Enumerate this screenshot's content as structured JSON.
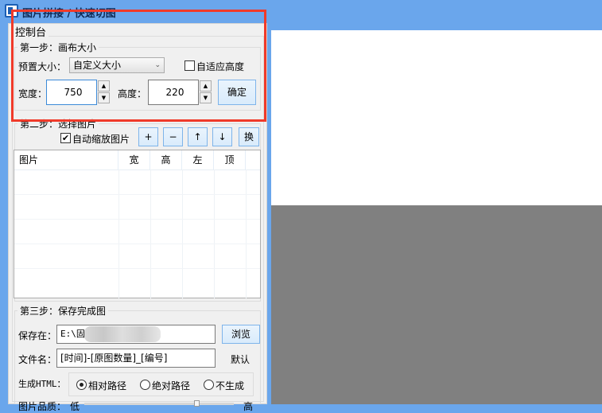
{
  "window": {
    "title": "图片拼接 / 快速切图"
  },
  "console": {
    "label": "控制台"
  },
  "step1": {
    "label": "第一步：画布大小",
    "preset_label": "预置大小：",
    "preset_value": "自定义大小",
    "auto_height_label": "自适应高度",
    "auto_height_checked": false,
    "width_label": "宽度：",
    "width_value": "750",
    "height_label": "高度：",
    "height_value": "220",
    "confirm": "确定"
  },
  "step2": {
    "label": "第二步：选择图片",
    "auto_scale_label": "自动缩放图片",
    "auto_scale_checked": true,
    "buttons": {
      "add": "+",
      "remove": "−",
      "up": "↑",
      "down": "↓",
      "swap": "换"
    },
    "columns": [
      "图片",
      "宽",
      "高",
      "左",
      "顶"
    ]
  },
  "step3": {
    "label": "第三步：保存完成图",
    "save_label": "保存在：",
    "save_value": "E:\\固",
    "browse": "浏览",
    "filename_label": "文件名：",
    "filename_value": "[时间]-[原图数量]_[编号]",
    "default": "默认",
    "html_label": "生成HTML：",
    "html_options": [
      "相对路径",
      "绝对路径",
      "不生成"
    ],
    "html_selected": 0,
    "quality_label": "图片品质：",
    "quality_low": "低",
    "quality_high": "高",
    "quality_value": 0.75
  }
}
